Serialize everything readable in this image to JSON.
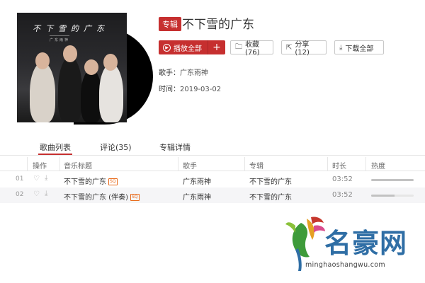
{
  "album": {
    "cover_title": "不下雪的广东",
    "cover_subtitle": "广东雨神",
    "badge": "专辑",
    "title": "不下雪的广东",
    "artist_label": "歌手：",
    "artist": "广东雨神",
    "date_label": "时间：",
    "date": "2019-03-02"
  },
  "actions": {
    "play_all": "播放全部",
    "add": "+",
    "collect": "收藏(76)",
    "share": "分享(12)",
    "download": "下载全部"
  },
  "tabs": [
    {
      "label": "歌曲列表",
      "active": true
    },
    {
      "label": "评论(35)",
      "active": false
    },
    {
      "label": "专辑详情",
      "active": false
    }
  ],
  "table": {
    "headers": [
      "操作",
      "音乐标题",
      "歌手",
      "专辑",
      "时长",
      "热度"
    ],
    "rows": [
      {
        "num": "01",
        "title": "不下雪的广东",
        "quality": "SQ",
        "artist": "广东雨神",
        "album": "不下雪的广东",
        "duration": "03:52",
        "heat": 1.0
      },
      {
        "num": "02",
        "title": "不下雪的广东 (伴奏)",
        "quality": "SQ",
        "artist": "广东雨神",
        "album": "不下雪的广东",
        "duration": "03:52",
        "heat": 0.55
      }
    ]
  },
  "watermark": {
    "brand": "名豪网",
    "url": "minghaoshangwu.com"
  },
  "colors": {
    "accent": "#c62f2f",
    "sq": "#e86a1a",
    "watermark": "#2f6ea5"
  }
}
